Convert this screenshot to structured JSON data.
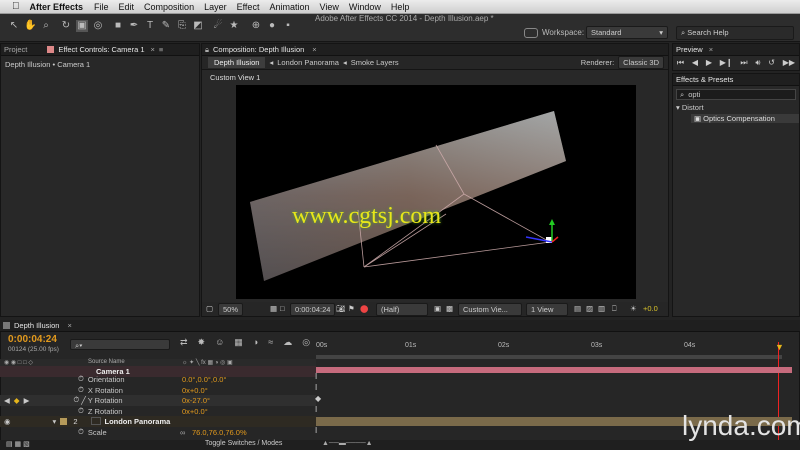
{
  "menubar": {
    "app": "After Effects",
    "items": [
      "File",
      "Edit",
      "Composition",
      "Layer",
      "Effect",
      "Animation",
      "View",
      "Window",
      "Help"
    ]
  },
  "window_title": "Adobe After Effects CC 2014 - Depth Illusion.aep *",
  "workspace": {
    "label": "Workspace:",
    "value": "Standard"
  },
  "search_help": "Search Help",
  "left_panel": {
    "tabs": [
      "Project",
      "Effect Controls: Camera 1"
    ],
    "breadcrumb": "Depth Illusion • Camera 1"
  },
  "comp_panel": {
    "tab": "Composition: Depth Illusion",
    "crumbs": [
      "Depth Illusion",
      "London Panorama",
      "Smoke Layers"
    ],
    "renderer_label": "Renderer:",
    "renderer": "Classic 3D",
    "view_label": "Custom View 1"
  },
  "viewer_bar": {
    "zoom": "50%",
    "time": "0:00:04:24",
    "resolution": "(Half)",
    "view": "Custom Vie...",
    "views": "1 View",
    "exposure": "+0.0"
  },
  "preview": {
    "title": "Preview"
  },
  "effects": {
    "title": "Effects & Presets",
    "search": "opti",
    "category": "Distort",
    "item": "Optics Compensation"
  },
  "timeline": {
    "tab": "Depth Illusion",
    "timecode": "0:00:04:24",
    "frames": "00124 (25.00 fps)",
    "col_source": "Source Name",
    "toggle": "Toggle Switches / Modes",
    "ruler": [
      "00s",
      "01s",
      "02s",
      "03s",
      "04s"
    ],
    "rows": [
      {
        "name": "Camera 1",
        "value": ""
      },
      {
        "name": "Orientation",
        "value": "0.0°,0.0°,0.0°"
      },
      {
        "name": "X Rotation",
        "value": "0x+0.0°"
      },
      {
        "name": "Y Rotation",
        "value": "0x-27.0°"
      },
      {
        "name": "Z Rotation",
        "value": "0x+0.0°"
      },
      {
        "num": "2",
        "name": "London Panorama",
        "value": ""
      },
      {
        "name": "Scale",
        "value": "76.0,76.0,76.0%"
      }
    ]
  },
  "watermark": "www.cgtsj.com",
  "brand": "lynda.com"
}
